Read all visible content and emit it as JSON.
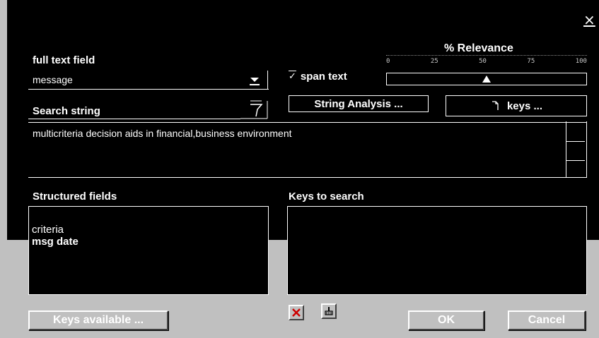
{
  "window": {
    "close_glyph": "×"
  },
  "full_text": {
    "label": "full text field",
    "value": "message"
  },
  "relevance": {
    "title": "% Relevance",
    "tick_labels": [
      "0",
      "25",
      "50",
      "75",
      "100"
    ],
    "value_percent": 50
  },
  "span_text": {
    "label": "span text",
    "checked": true,
    "check_glyph": "✓"
  },
  "search": {
    "label": "Search string",
    "value": "multicriteria decision aids in financial,business environment"
  },
  "buttons": {
    "string_analysis": "String Analysis ...",
    "keys": "keys ...",
    "keys_available": "Keys available ...",
    "ok": "OK",
    "cancel": "Cancel"
  },
  "structured_fields": {
    "label": "Structured fields",
    "items": [
      {
        "text": "criteria",
        "bold": false
      },
      {
        "text": "msg date",
        "bold": true
      }
    ]
  },
  "keys_to_search": {
    "label": "Keys to search",
    "items": []
  },
  "colors": {
    "background": "#000000",
    "foreground": "#ffffff",
    "panel_gray": "#c0c0c0",
    "delete_red": "#cc0000"
  },
  "icons": [
    "close-icon",
    "dropdown-arrow-icon",
    "funnel-icon",
    "checkmark-icon",
    "document-icon",
    "delete-icon",
    "brush-icon"
  ]
}
